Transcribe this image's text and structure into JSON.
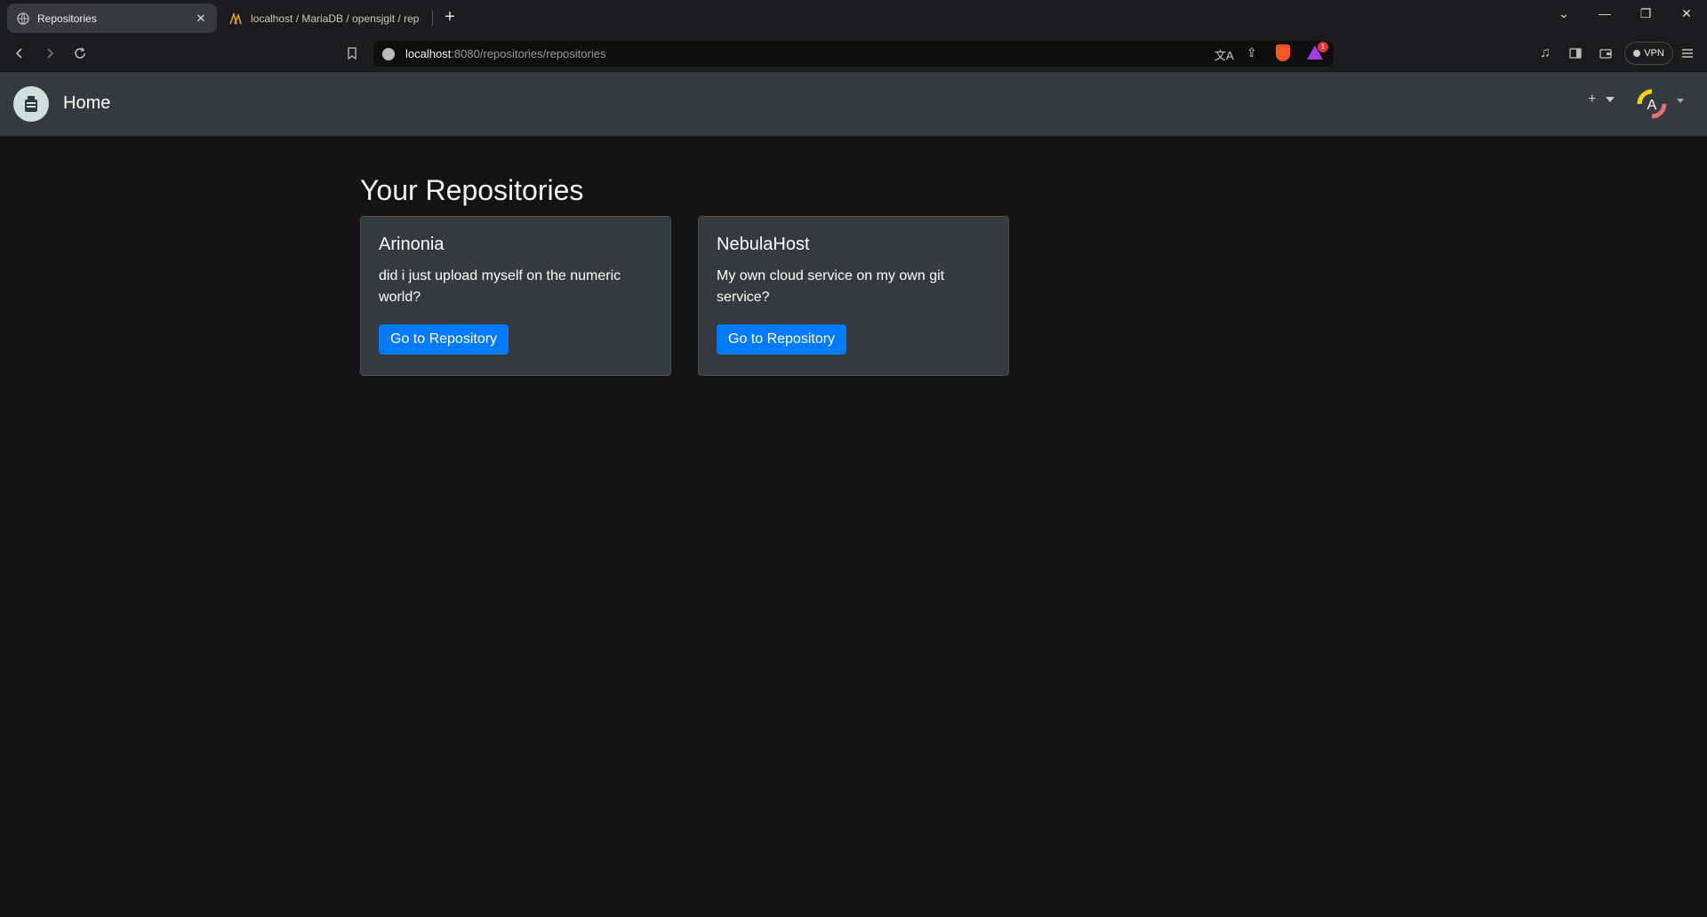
{
  "browser": {
    "tabs": [
      {
        "title": "Repositories",
        "active": true
      },
      {
        "title": "localhost / MariaDB / opensjgit / rep",
        "active": false
      }
    ],
    "url_host": "localhost",
    "url_rest": ":8080/repositories/repositories",
    "vpn_label": "VPN",
    "shields_badge": "1"
  },
  "navbar": {
    "brand": "Home",
    "plus_label": "+",
    "avatar_letter": "A"
  },
  "main": {
    "heading": "Your Repositories",
    "repositories": [
      {
        "name": "Arinonia",
        "description": "did i just upload myself on the numeric world?",
        "button": "Go to Repository"
      },
      {
        "name": "NebulaHost",
        "description": "My own cloud service on my own git service?",
        "button": "Go to Repository"
      }
    ]
  },
  "colors": {
    "accent": "#007bff",
    "navbar_bg": "#343a40",
    "page_bg": "#131313"
  }
}
